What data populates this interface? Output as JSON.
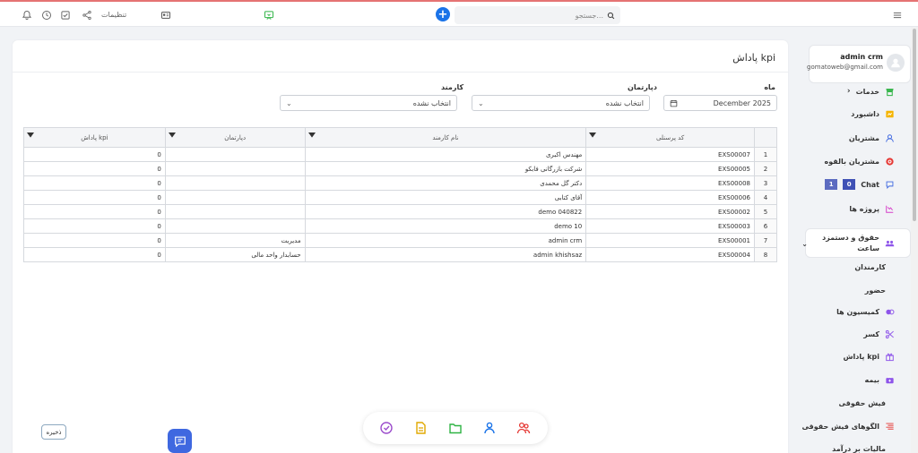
{
  "topbar": {
    "search_placeholder": "جستجو...",
    "settings_label": "تنظیمات"
  },
  "page": {
    "title": "پاداش kpi"
  },
  "filters": {
    "month_label": "ماه",
    "month_value": "December 2025",
    "department_label": "دپارتمان",
    "department_value": "انتخاب نشده",
    "employee_label": "کارمند",
    "employee_value": "انتخاب نشده"
  },
  "table": {
    "headers": [
      "کد پرسنلی",
      "نام کارمند",
      "دپارتمان",
      "پاداش kpi"
    ],
    "rows": [
      {
        "num": "1",
        "code": "EXS00007",
        "name": "مهندس اکبری",
        "dept": "",
        "kpi": "0"
      },
      {
        "num": "2",
        "code": "EXS00005",
        "name": "شرکت بازرگانی  فابکو",
        "dept": "",
        "kpi": "0"
      },
      {
        "num": "3",
        "code": "EXS00008",
        "name": "دکتر گل محمدی",
        "dept": "",
        "kpi": "0"
      },
      {
        "num": "4",
        "code": "EXS00006",
        "name": "آقای  کتابی",
        "dept": "",
        "kpi": "0"
      },
      {
        "num": "5",
        "code": "EXS00002",
        "name": "demo 040822",
        "dept": "",
        "kpi": "0"
      },
      {
        "num": "6",
        "code": "EXS00003",
        "name": "demo 10",
        "dept": "",
        "kpi": "0"
      },
      {
        "num": "7",
        "code": "EXS00001",
        "name": "admin crm",
        "dept": "مدیریت",
        "kpi": "0"
      },
      {
        "num": "8",
        "code": "EXS00004",
        "name": "admin khishsaz",
        "dept": "حسابدار واحد مالی",
        "kpi": "0"
      }
    ]
  },
  "profile": {
    "name": "admin crm",
    "email": "gomatoweb@gmail.com"
  },
  "sidebar": {
    "items": [
      {
        "label": "خدمات",
        "icon": "store-icon"
      },
      {
        "label": "داشبورد",
        "icon": "dashboard-icon"
      },
      {
        "label": "مشتریان",
        "icon": "user-icon"
      },
      {
        "label": "مشتریان بالقوه",
        "icon": "target-icon"
      },
      {
        "label": "Chat",
        "icon": "chat-icon",
        "badge_a": "0",
        "badge_b": "1"
      },
      {
        "label": "پروژه ها",
        "icon": "chart-icon"
      },
      {
        "label": "حقوق و دستمزد ساعت",
        "icon": "group-icon"
      },
      {
        "label": "کارمندان",
        "icon": ""
      },
      {
        "label": "حضور",
        "icon": ""
      },
      {
        "label": "کمیسیون ها",
        "icon": "coins-icon"
      },
      {
        "label": "کسر",
        "icon": "scissors-icon"
      },
      {
        "label": "پاداش kpi",
        "icon": "gift-icon"
      },
      {
        "label": "بیمه",
        "icon": "medkit-icon"
      },
      {
        "label": "فیش حقوقی",
        "icon": ""
      },
      {
        "label": "الگوهای فیش حقوقی",
        "icon": "list-icon"
      },
      {
        "label": "مالیات بر درآمد",
        "icon": ""
      }
    ]
  },
  "footer": {
    "save_label": "ذخیره"
  },
  "colors": {
    "accent": "#1a73e8",
    "fab": "#3f68e0",
    "chat_badge_a": "#3f51b5",
    "chat_badge_b": "#5c6bc0"
  }
}
